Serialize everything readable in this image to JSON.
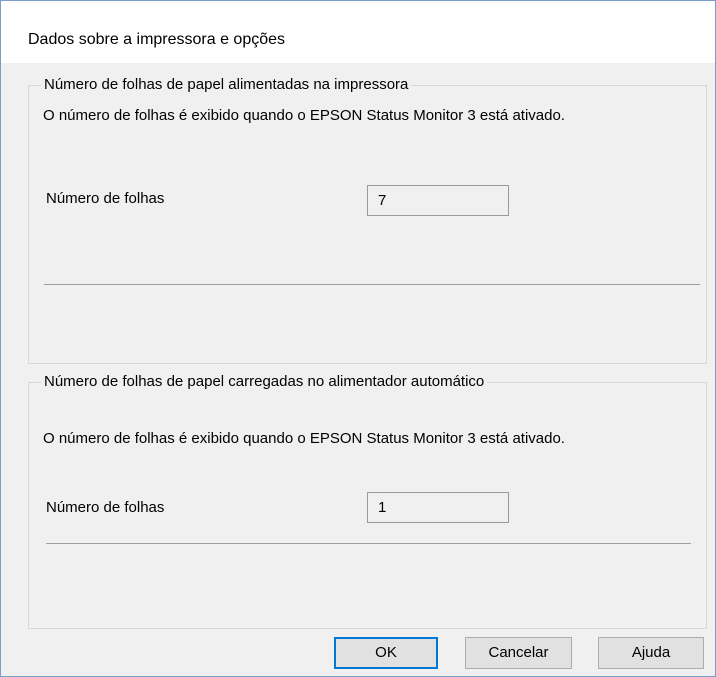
{
  "window": {
    "title": "Dados sobre a impressora e opções"
  },
  "group_printer": {
    "legend": "Número de folhas de papel alimentadas na impressora",
    "note": "O número de folhas é exibido quando o EPSON Status Monitor 3 está ativado.",
    "field_label": "Número de folhas",
    "field_value": "7"
  },
  "group_feeder": {
    "legend": "Número de folhas de papel carregadas no alimentador automático",
    "note": "O número de folhas é exibido quando o EPSON Status Monitor 3 está ativado.",
    "field_label": "Número de folhas",
    "field_value": "1"
  },
  "buttons": {
    "ok": "OK",
    "cancel": "Cancelar",
    "help": "Ajuda"
  },
  "colors": {
    "accent": "#0078d7",
    "dialog_bg": "#f0f0f0"
  }
}
